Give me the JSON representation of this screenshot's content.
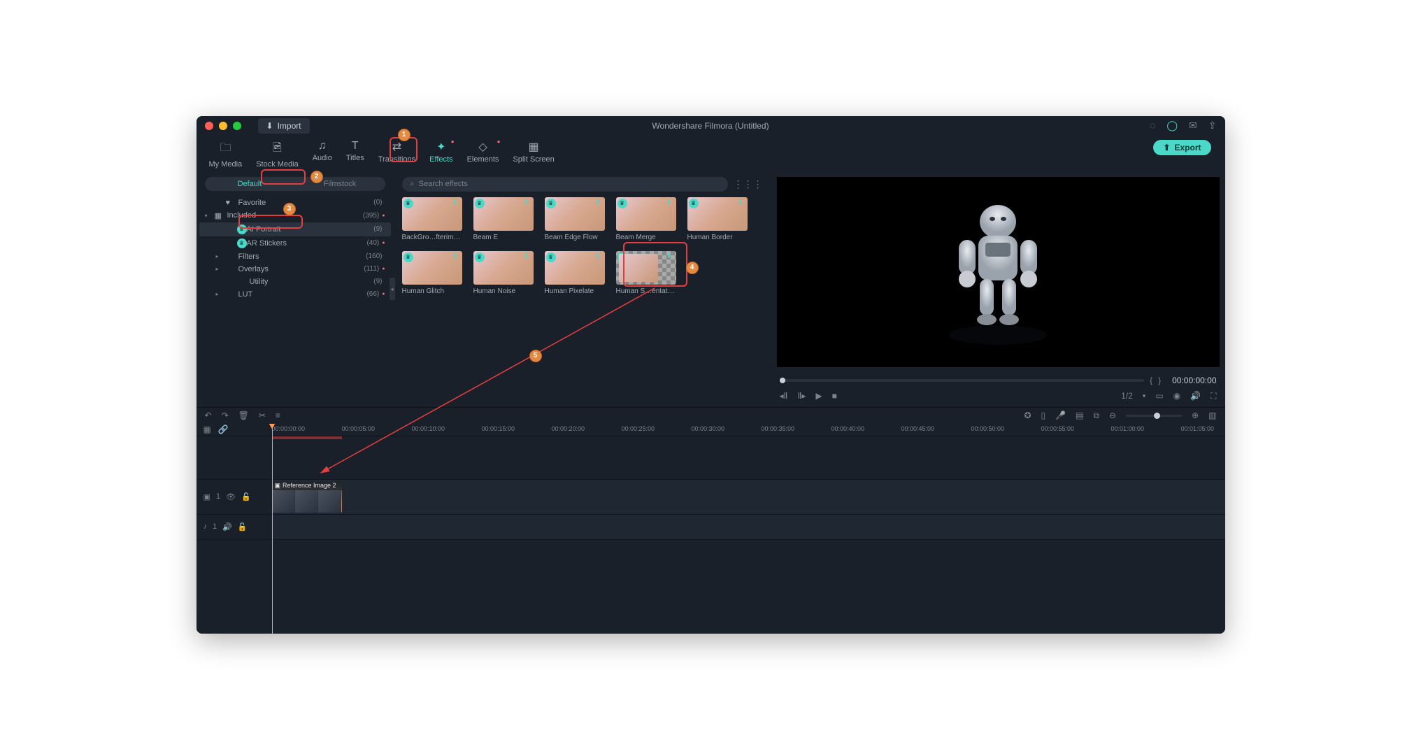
{
  "window": {
    "title": "Wondershare Filmora (Untitled)",
    "import": "Import"
  },
  "topTabs": [
    {
      "label": "My Media",
      "icon": "🗀"
    },
    {
      "label": "Stock Media",
      "icon": "🖻"
    },
    {
      "label": "Audio",
      "icon": "♫"
    },
    {
      "label": "Titles",
      "icon": "T"
    },
    {
      "label": "Transitions",
      "icon": "⇄"
    },
    {
      "label": "Effects",
      "icon": "✦",
      "active": true,
      "dot": true
    },
    {
      "label": "Elements",
      "icon": "◇",
      "dot": true
    },
    {
      "label": "Split Screen",
      "icon": "▦"
    }
  ],
  "export": "Export",
  "pillTabs": {
    "default": "Default",
    "filmstock": "Filmstock"
  },
  "tree": [
    {
      "type": "leaf",
      "icon": "♥",
      "label": "Favorite",
      "count": "(0)",
      "indent": 1
    },
    {
      "type": "parent",
      "open": true,
      "icon": "▦",
      "label": "Included",
      "count": "(395)",
      "dot": true,
      "indent": 0
    },
    {
      "type": "leaf",
      "icon": "👑",
      "label": "AI Portrait",
      "count": "(9)",
      "indent": 2,
      "selected": true,
      "crown": true
    },
    {
      "type": "leaf",
      "icon": "👑",
      "label": "AR Stickers",
      "count": "(40)",
      "dot": true,
      "indent": 2,
      "crown": true
    },
    {
      "type": "parent",
      "open": false,
      "label": "Filters",
      "count": "(160)",
      "indent": 1
    },
    {
      "type": "parent",
      "open": false,
      "label": "Overlays",
      "count": "(111)",
      "dot": true,
      "indent": 1
    },
    {
      "type": "leaf",
      "label": "Utility",
      "count": "(9)",
      "indent": 2,
      "noicon": true
    },
    {
      "type": "parent",
      "open": false,
      "label": "LUT",
      "count": "(66)",
      "dot": true,
      "indent": 1
    }
  ],
  "search": {
    "placeholder": "Search effects"
  },
  "effects": [
    {
      "label": "BackGro…fterimage"
    },
    {
      "label": "Beam E"
    },
    {
      "label": "Beam Edge Flow"
    },
    {
      "label": "Beam Merge"
    },
    {
      "label": "Human Border"
    },
    {
      "label": "Human Glitch"
    },
    {
      "label": "Human Noise"
    },
    {
      "label": "Human Pixelate"
    },
    {
      "label": "Human S…entation",
      "segmented": true,
      "highlight": true
    }
  ],
  "preview": {
    "timecode": "00:00:00:00",
    "ratio": "1/2"
  },
  "ruler": {
    "ticks": [
      "00:00:00:00",
      "00:00:05:00",
      "00:00:10:00",
      "00:00:15:00",
      "00:00:20:00",
      "00:00:25:00",
      "00:00:30:00",
      "00:00:35:00",
      "00:00:40:00",
      "00:00:45:00",
      "00:00:50:00",
      "00:00:55:00",
      "00:01:00:00",
      "00:01:05:00"
    ]
  },
  "clip": {
    "label": "Reference Image 2"
  },
  "tracks": {
    "video": "1",
    "audio": "1"
  },
  "annotations": {
    "n1": "1",
    "n2": "2",
    "n3": "3",
    "n4": "4",
    "n5": "5"
  }
}
